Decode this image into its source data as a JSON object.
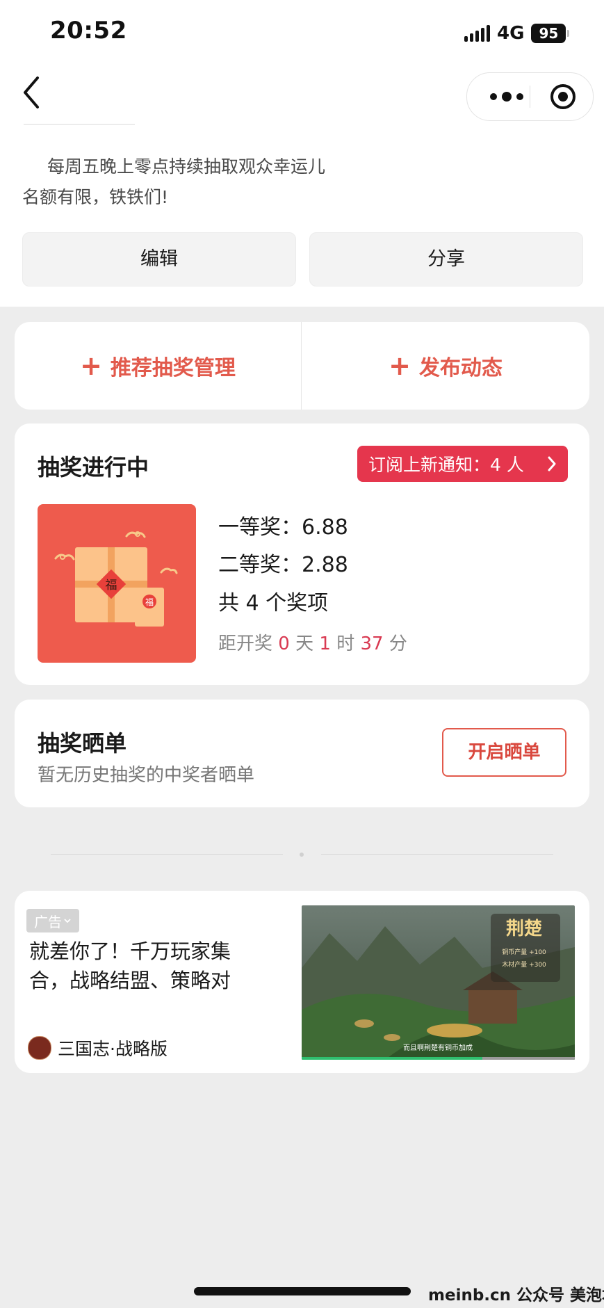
{
  "status_bar": {
    "time": "20:52",
    "network": "4G",
    "battery": "95"
  },
  "nav": {
    "back_icon": "chevron-left-icon",
    "more_icon": "more-dots-icon",
    "close_icon": "target-circle-icon"
  },
  "profile": {
    "description_line1": "每周五晚上零点持续抽取观众幸运儿",
    "description_line2": "名额有限，铁铁们!",
    "edit_label": "编辑",
    "share_label": "分享"
  },
  "actions": {
    "recommend_label": "推荐抽奖管理",
    "publish_label": "发布动态",
    "plus_icon": "plus-icon"
  },
  "lottery": {
    "title": "抽奖进行中",
    "subscribe_label": "订阅上新通知：4 人",
    "prize_image_icon": "gift-box-icon",
    "prize1": "一等奖：6.88",
    "prize2": "二等奖：2.88",
    "total": "共 4 个奖项",
    "countdown": {
      "prefix": "距开奖",
      "days": "0",
      "days_unit": "天",
      "hours": "1",
      "hours_unit": "时",
      "minutes": "37",
      "minutes_unit": "分"
    }
  },
  "showcase": {
    "title": "抽奖晒单",
    "subtitle": "暂无历史抽奖的中奖者晒单",
    "button_label": "开启晒单"
  },
  "ad": {
    "tag": "广告",
    "text": "就差你了！千万玩家集合，战略结盟、策略对",
    "brand": "三国志·战略版",
    "image_icon": "game-scene-image",
    "image_title": "荆楚",
    "image_stat1": "铜币产量 +100",
    "image_stat2": "木材产量 +300",
    "image_caption": "而且啊荆楚有铜币加成"
  },
  "watermark": "meinb.cn  公众号 美泡君",
  "colors": {
    "accent_red": "#e25a4c",
    "subscribe_red": "#e5364d",
    "countdown_red": "#d93a52",
    "page_bg": "#ededed"
  }
}
